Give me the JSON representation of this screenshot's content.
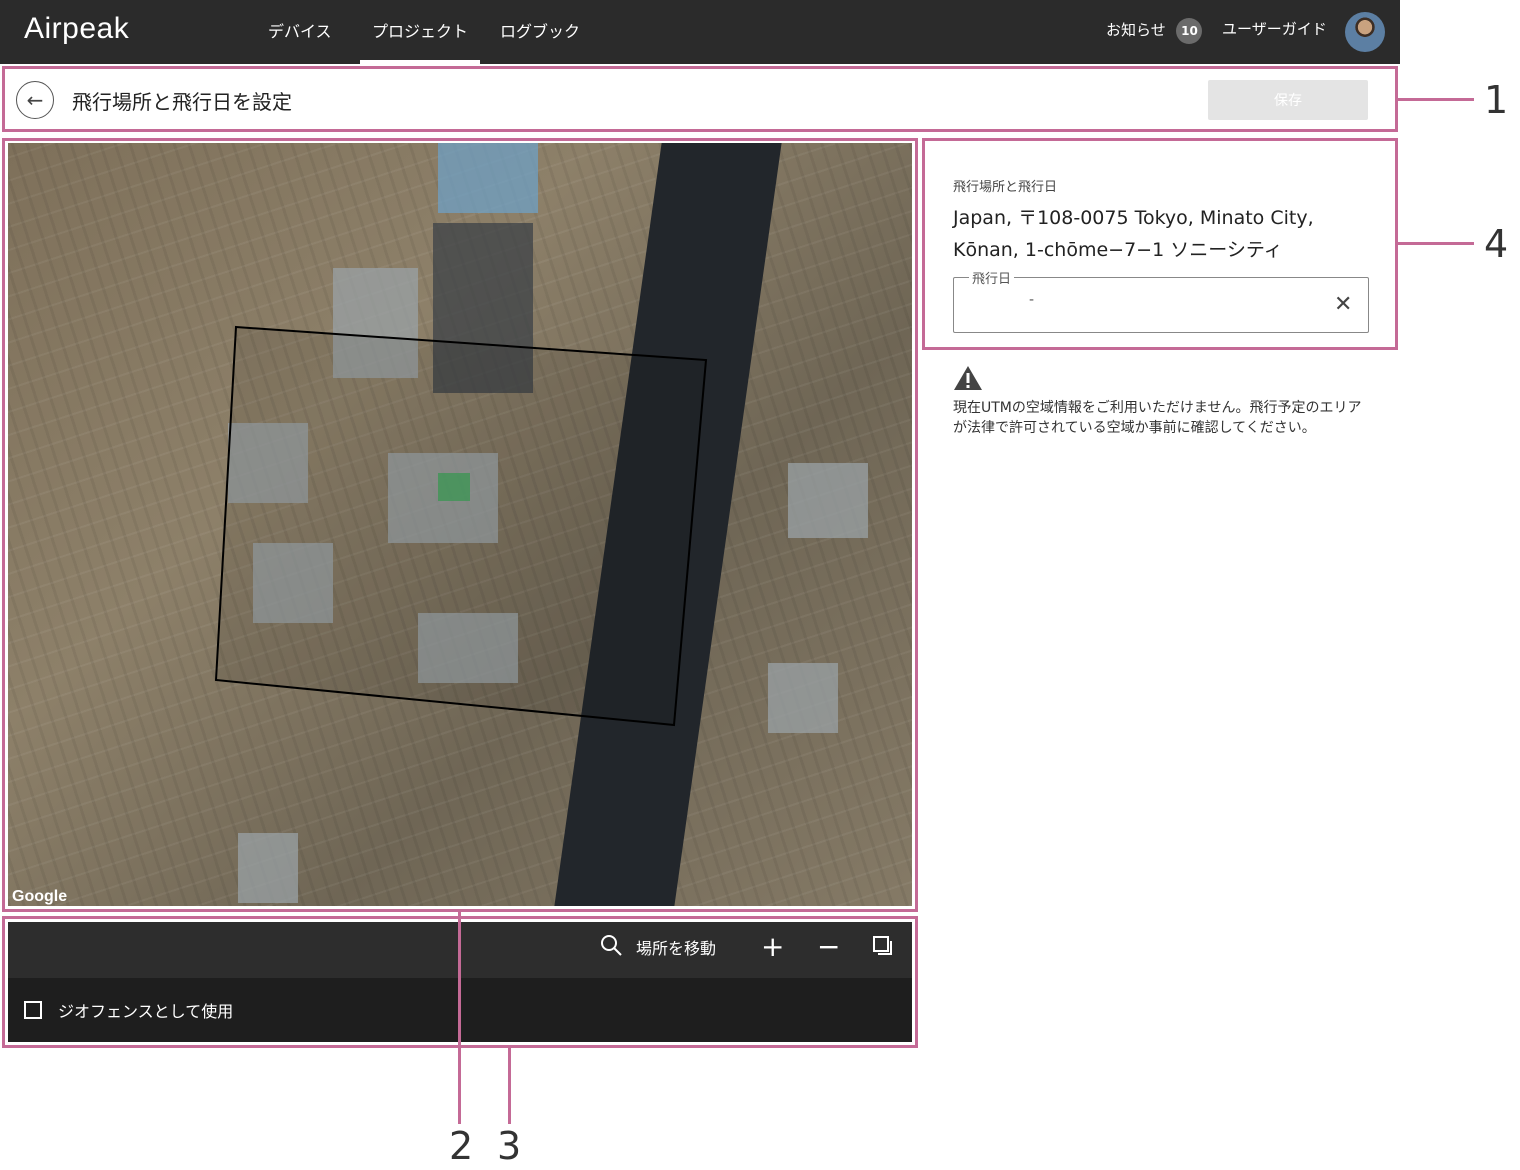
{
  "nav": {
    "logo": "Airpeak",
    "tabs": [
      "デバイス",
      "プロジェクト",
      "ログブック"
    ],
    "notifications_label": "お知らせ",
    "notifications_count": "10",
    "user_guide": "ユーザーガイド"
  },
  "header": {
    "title": "飛行場所と飛行日を設定",
    "save": "保存"
  },
  "map": {
    "attribution": "Google"
  },
  "toolbar": {
    "move_location": "場所を移動",
    "geofence_label": "ジオフェンスとして使用"
  },
  "panel": {
    "section_label": "飛行場所と飛行日",
    "address": "Japan, 〒108-0075 Tokyo, Minato City, Kōnan, 1-chōme−7−1 ソニーシティ",
    "date_label": "飛行日",
    "date_value": "-",
    "warning": "現在UTMの空域情報をご利用いただけません。飛行予定のエリアが法律で許可されている空域か事前に確認してください。"
  },
  "callouts": [
    "1",
    "2",
    "3",
    "4"
  ],
  "colors": {
    "annotation": "#c46a96",
    "nav_bg": "#2b2b2b",
    "toolbar_bg": "#2d2d2d"
  }
}
